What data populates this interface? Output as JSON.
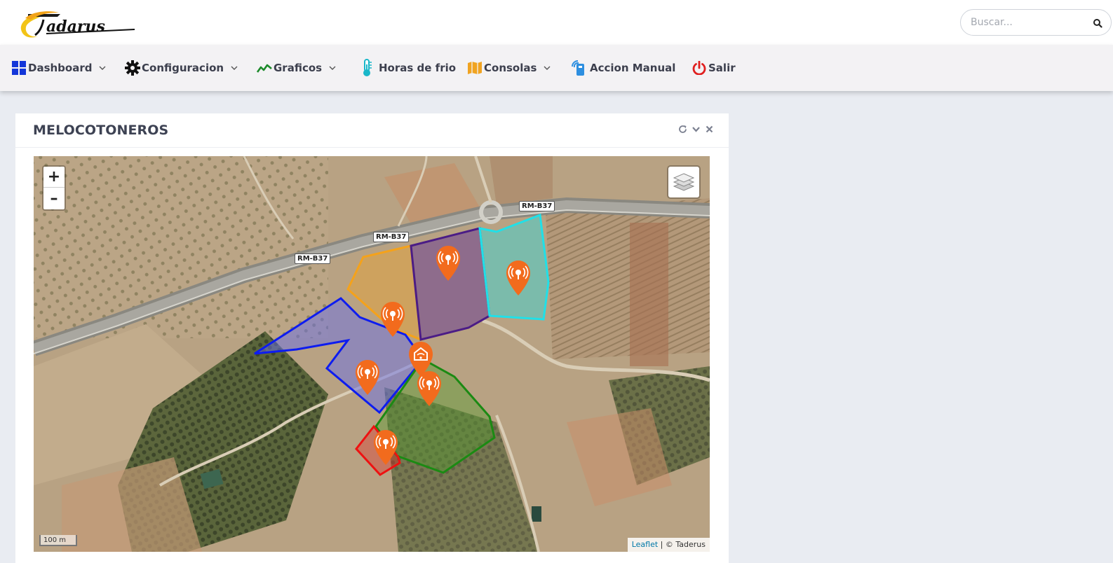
{
  "header": {
    "logo_text": "Taderus",
    "search_placeholder": "Buscar..."
  },
  "nav": [
    {
      "label": "Dashboard",
      "icon": "dashboard-grid-icon",
      "color": "#1336d9",
      "dropdown": true
    },
    {
      "label": "Configuracion",
      "icon": "gear-icon",
      "color": "#111111",
      "dropdown": true
    },
    {
      "label": "Graficos",
      "icon": "line-chart-icon",
      "color": "#1c8a2a",
      "dropdown": true
    },
    {
      "label": "Horas de frio",
      "icon": "thermometer-icon",
      "color": "#19b7c9",
      "dropdown": false
    },
    {
      "label": "Consolas",
      "icon": "map-icon",
      "color": "#f0a320",
      "dropdown": true
    },
    {
      "label": "Accion Manual",
      "icon": "remote-control-icon",
      "color": "#2d8fe0",
      "dropdown": false
    },
    {
      "label": "Salir",
      "icon": "power-icon",
      "color": "#e01f1f",
      "dropdown": false
    }
  ],
  "panel": {
    "title": "MELOCOTONEROS",
    "tools": [
      "refresh-icon",
      "collapse-icon",
      "close-icon"
    ]
  },
  "map": {
    "zoom_in": "+",
    "zoom_out": "–",
    "scale_label": "100 m",
    "attribution_link": "Leaflet",
    "attribution_text": " | © Taderus",
    "road_labels": [
      "RM-B37",
      "RM-B37",
      "RM-B37"
    ],
    "marker_color": "#f26b1d",
    "plots": [
      {
        "name": "orange-plot",
        "color": "#f5a21a"
      },
      {
        "name": "purple-plot",
        "color": "#4b1c86"
      },
      {
        "name": "cyan-plot",
        "color": "#20e0e8"
      },
      {
        "name": "blue-plot",
        "color": "#0d1cf0"
      },
      {
        "name": "green-plot",
        "color": "#1b8a13"
      },
      {
        "name": "red-plot",
        "color": "#ee1111"
      }
    ]
  }
}
